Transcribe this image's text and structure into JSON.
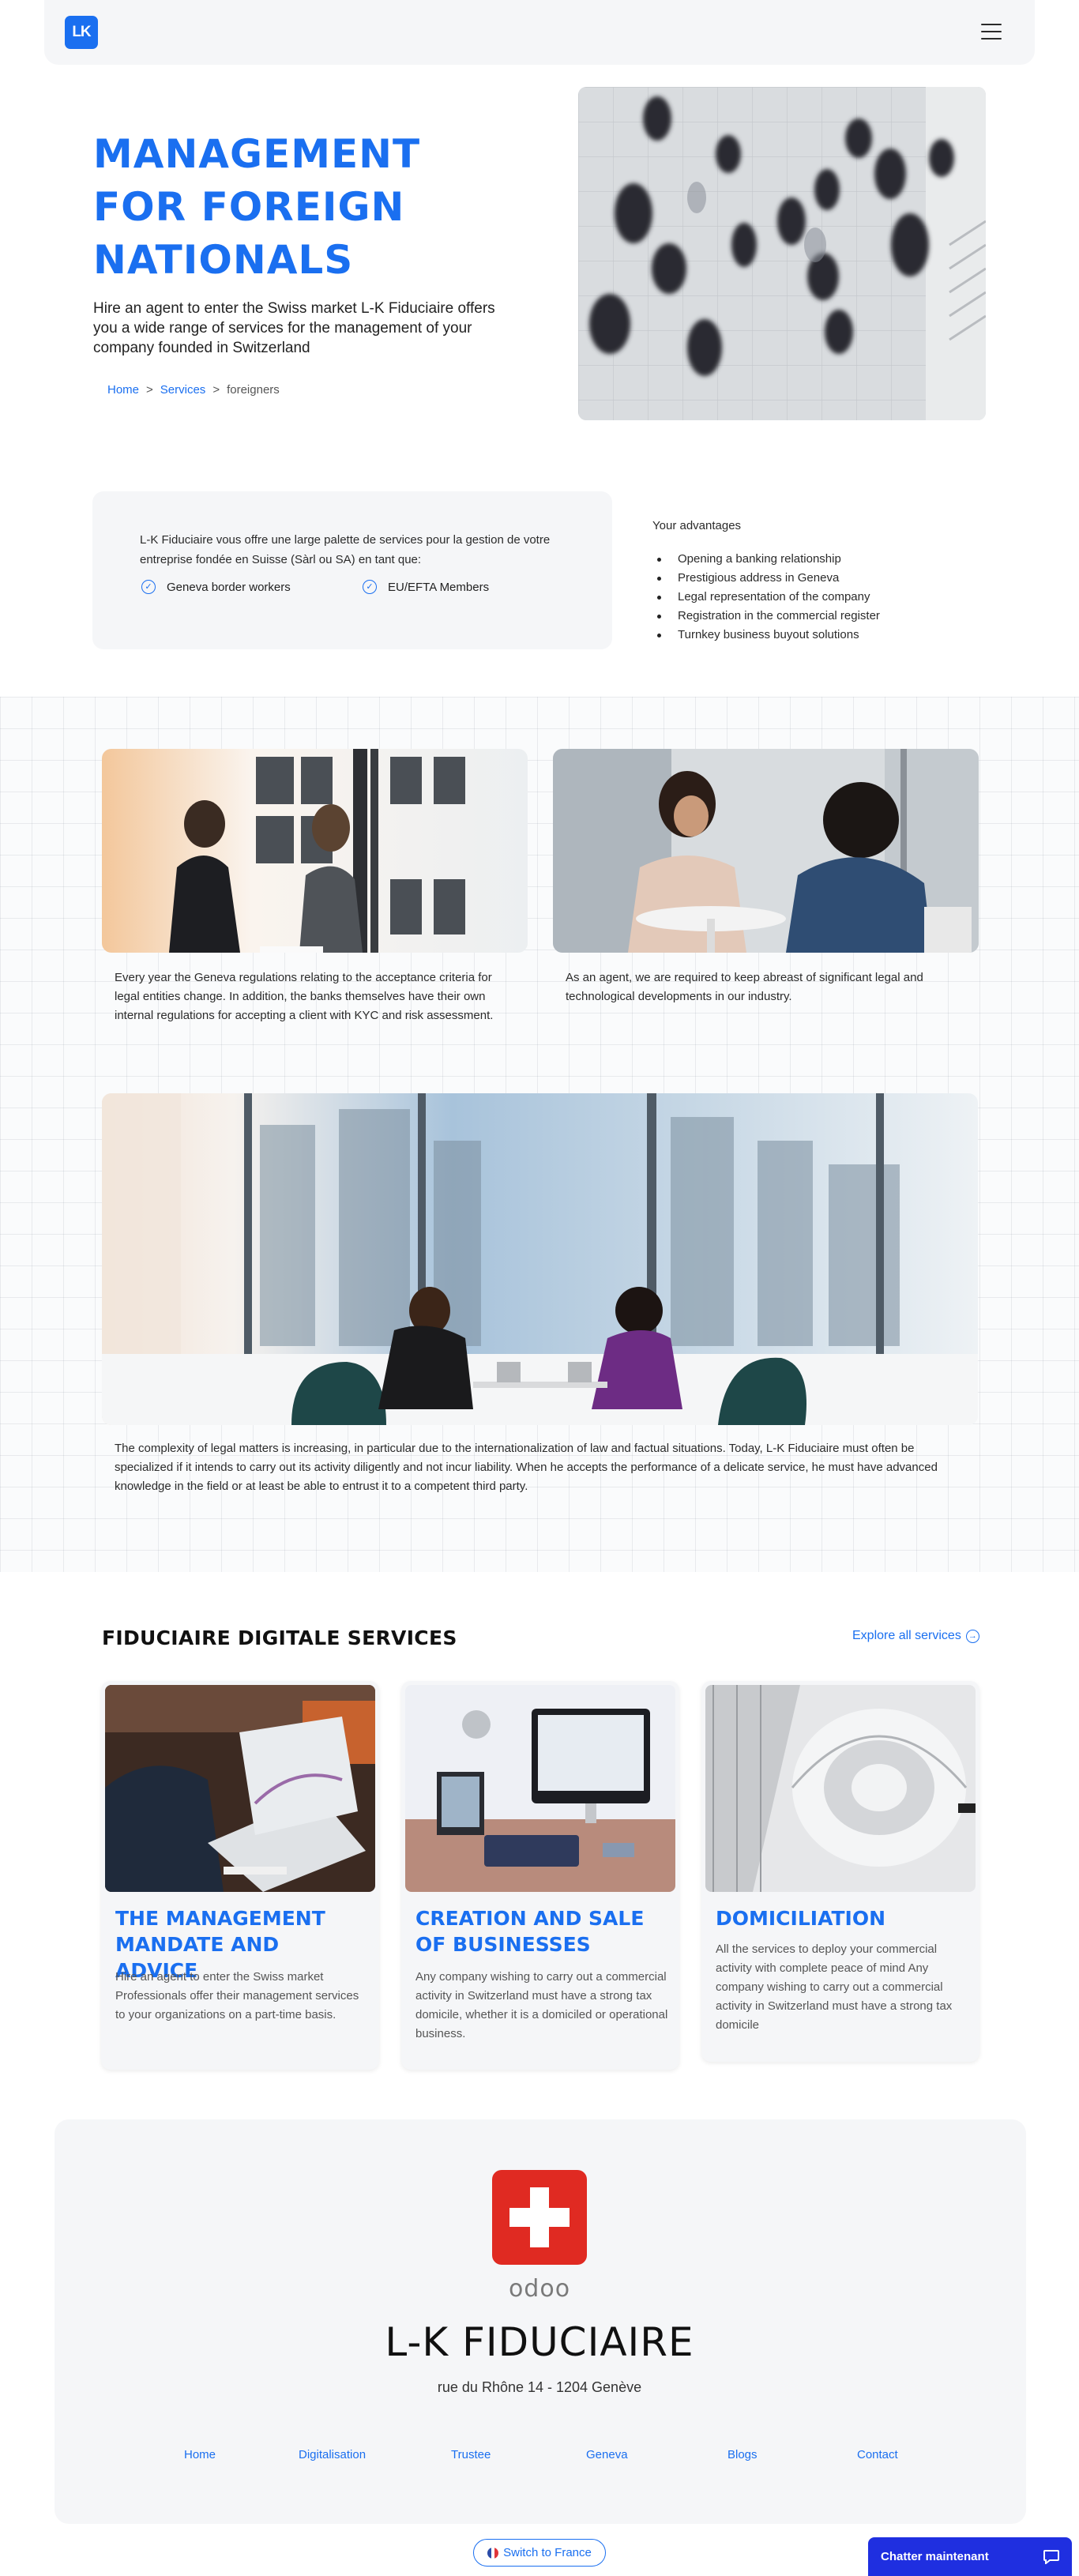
{
  "header": {
    "logo_text": "LK",
    "brand_color": "#1a6ff0"
  },
  "hero": {
    "title": "MANAGEMENT FOR FOREIGN NATIONALS",
    "description": "Hire an agent to enter the Swiss market L-K Fiduciaire offers you a wide range of services for the management of your company founded in Switzerland",
    "breadcrumb": {
      "home": "Home",
      "sep1": ">",
      "services": "Services",
      "sep2": ">",
      "current": "foreigners"
    }
  },
  "intro": {
    "text": "L-K Fiduciaire vous offre une large palette de services pour la gestion de votre entreprise fondée en Suisse (Sàrl ou SA) en tant que:",
    "checks": [
      "Geneva border workers",
      "EU/EFTA Members"
    ]
  },
  "advantages": {
    "title": "Your advantages",
    "items": [
      "Opening a banking relationship",
      "Prestigious address in Geneva",
      "Legal representation of the company",
      "Registration in the commercial register",
      "Turnkey business buyout solutions"
    ]
  },
  "band": {
    "text_left": "Every year the Geneva regulations relating to the acceptance criteria for legal entities change. In addition, the banks themselves have their own internal regulations for accepting a client with KYC and risk assessment.",
    "text_right": "As an agent, we are required to keep abreast of significant legal and technological developments in our industry.",
    "text_wide": "The complexity of legal matters is increasing, in particular due to the internationalization of law and factual situations. Today, L-K Fiduciaire must often be specialized if it intends to carry out its activity diligently and not incur liability. When he accepts the performance of a delicate service, he must have advanced knowledge in the field or at least be able to entrust it to a competent third party."
  },
  "services": {
    "heading": "FIDUCIAIRE DIGITALE SERVICES",
    "explore": "Explore all services",
    "cards": [
      {
        "title": "THE MANAGEMENT MANDATE AND ADVICE",
        "body": "Hire an agent to enter the Swiss market Professionals offer their management services to your organizations on a part-time basis."
      },
      {
        "title": "CREATION AND SALE OF BUSINESSES",
        "body": "Any company wishing to carry out a commercial activity in Switzerland must have a strong tax domicile, whether it is a domiciled or operational business."
      },
      {
        "title": "DOMICILIATION",
        "body": "All the services to deploy your commercial activity with complete peace of mind Any company wishing to carry out a commercial activity in Switzerland must have a strong tax domicile"
      }
    ]
  },
  "footer": {
    "odoo": "odoo",
    "company": "L-K FIDUCIAIRE",
    "address": "rue du Rhône 14 - 1204 Genève",
    "links": [
      "Home",
      "Digitalisation",
      "Trustee",
      "Geneva",
      "Blogs",
      "Contact"
    ],
    "switch": "Switch to France",
    "chat": "Chatter maintenant",
    "flag_color": "#e02a22"
  }
}
